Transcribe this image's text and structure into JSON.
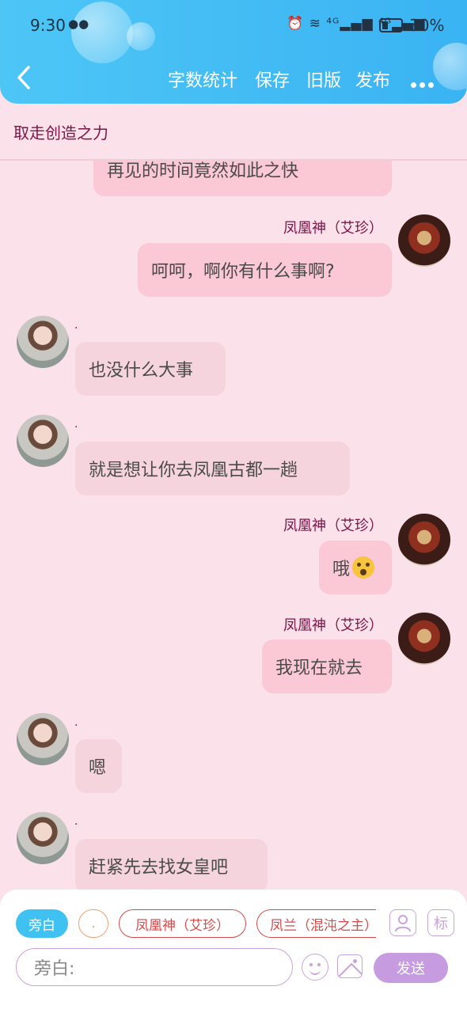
{
  "status_bar": {
    "time": "9:30",
    "wechat_icon": "wechat-icon",
    "signal_icons": "⏰ ≋ ⁴ᴳ▂▄▆ ⁴ᴳ▂▄▆",
    "battery": "30%"
  },
  "header": {
    "back_icon": "chevron-left-icon",
    "actions": [
      "字数统计",
      "保存",
      "旧版",
      "发布"
    ],
    "more_icon": "more-horizontal-icon",
    "gradient": [
      "#4dc6f6",
      "#3ab3f3"
    ]
  },
  "chat_title": "取走创造之力",
  "messages": [
    {
      "side": "right",
      "text": "再见的时间竟然如此之快"
    },
    {
      "side": "right",
      "sender": "凤凰神（艾珍）",
      "text": "呵呵，啊你有什么事啊?"
    },
    {
      "side": "left",
      "sender": ".",
      "text": "也没什么大事"
    },
    {
      "side": "left",
      "sender": ".",
      "text": "就是想让你去凤凰古都一趟"
    },
    {
      "side": "right",
      "sender": "凤凰神（艾珍）",
      "text": "哦",
      "emoji": "astonished-face-emoji"
    },
    {
      "side": "right",
      "sender": "凤凰神（艾珍）",
      "text": "我现在就去"
    },
    {
      "side": "left",
      "sender": ".",
      "text": "嗯"
    },
    {
      "side": "left",
      "sender": ".",
      "text": "赶紧先去找女皇吧"
    }
  ],
  "role_chips": [
    "旁白",
    ".",
    "凤凰神（艾珍）",
    "凤兰（混沌之主）"
  ],
  "tools": {
    "character_icon": "person-icon",
    "tag_label": "标"
  },
  "composer": {
    "placeholder": "旁白:",
    "emoji_icon": "smiley-icon",
    "image_icon": "image-icon",
    "send_label": "发送"
  },
  "colors": {
    "background": "#fbe1ea",
    "right_bubble": "#fbc8d5",
    "left_bubble": "#f5d4dd",
    "accent": "#c79be0",
    "name": "#7a1546"
  }
}
